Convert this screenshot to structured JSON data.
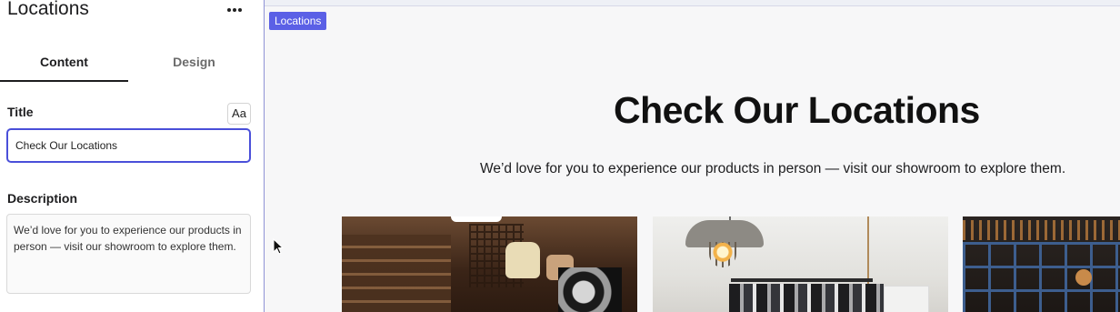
{
  "panel": {
    "title": "Locations",
    "tabs": [
      {
        "label": "Content",
        "active": true
      },
      {
        "label": "Design",
        "active": false
      }
    ],
    "title_field": {
      "label": "Title",
      "format_button": "Aa",
      "value": "Check Our Locations"
    },
    "description_field": {
      "label": "Description",
      "value": "We’d love for you to experience our products in person — visit our showroom to explore them."
    }
  },
  "preview": {
    "section_tag": "Locations",
    "heading": "Check Our Locations",
    "subheading": "We’d love for you to experience our products in person — visit our showroom to explore them.",
    "cards": [
      {
        "image": "shop-interior-photo"
      },
      {
        "image": "clothing-rack-lamp-photo"
      },
      {
        "image": "storefront-window-photo"
      }
    ]
  },
  "colors": {
    "accent": "#4a4fd9",
    "tag_bg": "#5b60e6",
    "preview_bg": "#f7f7f8"
  },
  "icons": {
    "more": "more-horizontal-icon",
    "cursor": "mouse-pointer-icon"
  }
}
